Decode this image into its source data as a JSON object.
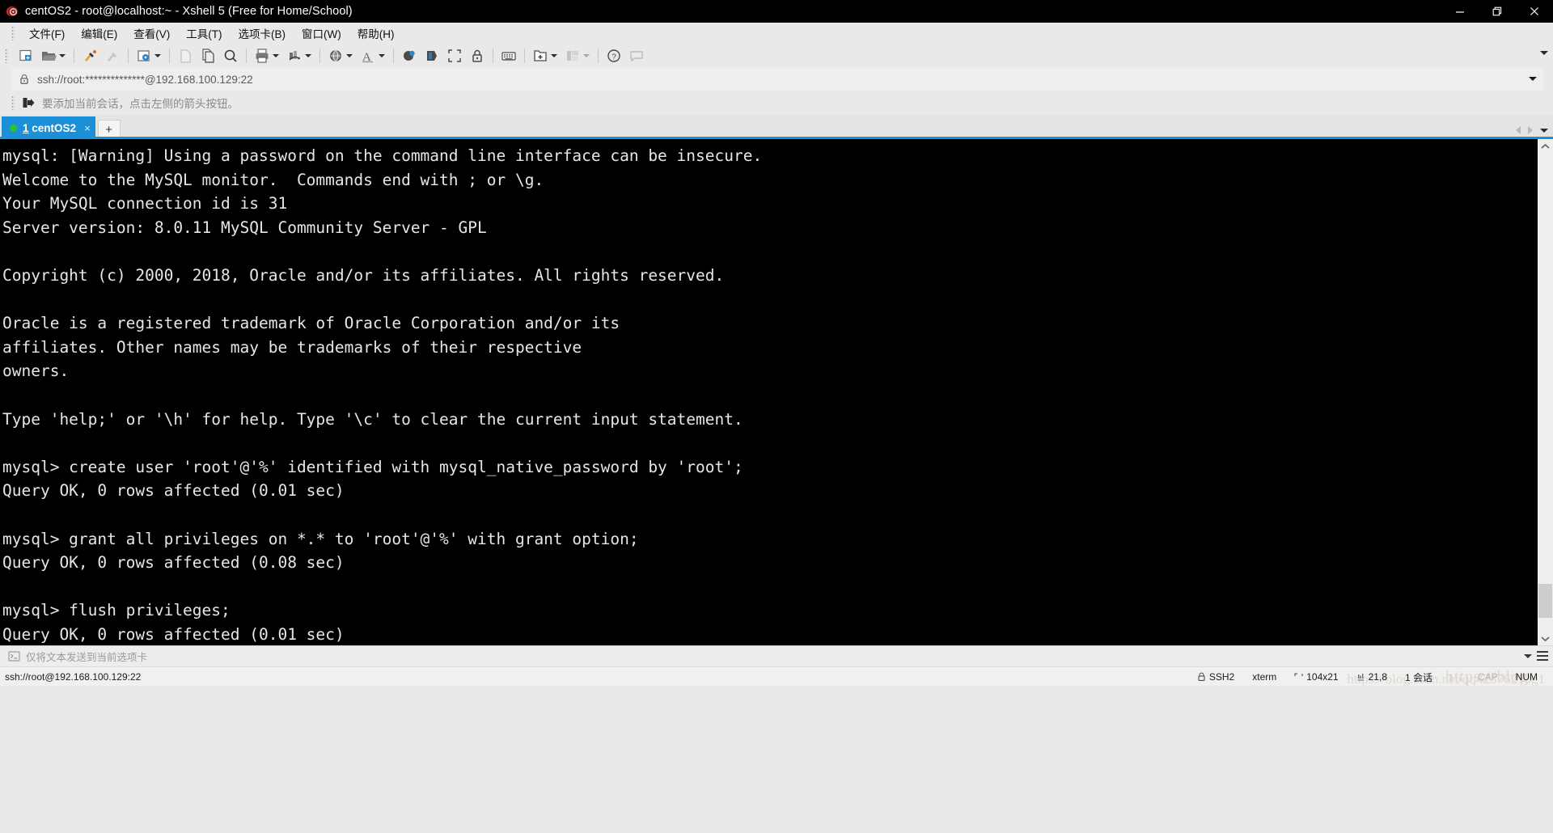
{
  "window": {
    "title": "centOS2 - root@localhost:~ - Xshell 5 (Free for Home/School)",
    "app_icon": "xshell-logo-icon",
    "minimize": "—",
    "restore": "❐",
    "close": "✕"
  },
  "menubar": {
    "items": [
      {
        "label": "文件(F)",
        "name": "menu-file"
      },
      {
        "label": "编辑(E)",
        "name": "menu-edit"
      },
      {
        "label": "查看(V)",
        "name": "menu-view"
      },
      {
        "label": "工具(T)",
        "name": "menu-tools"
      },
      {
        "label": "选项卡(B)",
        "name": "menu-tabs"
      },
      {
        "label": "窗口(W)",
        "name": "menu-window"
      },
      {
        "label": "帮助(H)",
        "name": "menu-help"
      }
    ]
  },
  "toolbar": {
    "items": [
      "new-session-icon",
      "open-folder-icon",
      "folder-dropdown-caret",
      "separator",
      "connect-icon",
      "disconnect-icon",
      "separator",
      "session-properties-icon",
      "properties-dropdown-caret",
      "separator",
      "cut-icon",
      "copy-icon",
      "find-icon",
      "separator",
      "print-icon",
      "print-dropdown-caret",
      "log-icon",
      "log-dropdown-caret",
      "separator",
      "globe-icon",
      "globe-dropdown-caret",
      "font-icon",
      "font-dropdown-caret",
      "separator",
      "compose-pane-icon",
      "highlight-icon",
      "fullscreen-icon",
      "lock-icon",
      "separator",
      "keyboard-icon",
      "separator",
      "new-folder-icon",
      "new-folder-dropdown-caret",
      "layout-icon",
      "layout-dropdown-caret",
      "separator",
      "help-icon",
      "feedback-icon"
    ],
    "overflow": "toolbar-overflow-caret"
  },
  "address_bar": {
    "lock_icon": "lock-icon",
    "value": "ssh://root:**************@192.168.100.129:22",
    "placeholder": "ssh://",
    "dropdown": "address-dropdown-caret"
  },
  "hint_bar": {
    "icon": "add-session-arrow-icon",
    "text": "要添加当前会话，点击左侧的箭头按钮。"
  },
  "tabbar": {
    "tabs": [
      {
        "index": "1",
        "label": "centOS2",
        "status": "connected",
        "close": "×"
      }
    ],
    "new_tab": "+",
    "nav_left": "tab-nav-left-icon",
    "nav_right": "tab-nav-right-icon",
    "tab_list": "tab-list-caret"
  },
  "terminal": {
    "lines": [
      "mysql: [Warning] Using a password on the command line interface can be insecure.",
      "Welcome to the MySQL monitor.  Commands end with ; or \\g.",
      "Your MySQL connection id is 31",
      "Server version: 8.0.11 MySQL Community Server - GPL",
      "",
      "Copyright (c) 2000, 2018, Oracle and/or its affiliates. All rights reserved.",
      "",
      "Oracle is a registered trademark of Oracle Corporation and/or its",
      "affiliates. Other names may be trademarks of their respective",
      "owners.",
      "",
      "Type 'help;' or '\\h' for help. Type '\\c' to clear the current input statement.",
      "",
      "mysql> create user 'root'@'%' identified with mysql_native_password by 'root';",
      "Query OK, 0 rows affected (0.01 sec)",
      "",
      "mysql> grant all privileges on *.* to 'root'@'%' with grant option;",
      "Query OK, 0 rows affected (0.08 sec)",
      "",
      "mysql> flush privileges;",
      "Query OK, 0 rows affected (0.01 sec)"
    ],
    "background": "#000000",
    "foreground": "#e6e6e6"
  },
  "send_bar": {
    "icon": "terminal-prompt-icon",
    "placeholder": "仅将文本发送到当前选项卡",
    "value": "",
    "dropdown": "send-bar-caret",
    "menu": "send-bar-menu-icon"
  },
  "status_bar": {
    "left": "ssh://root@192.168.100.129:22",
    "protocol_icon": "lock-icon",
    "protocol": "SSH2",
    "terminal_type": "xterm",
    "size_icon": "screen-size-icon",
    "size": "104x21",
    "cursor_icon": "cursor-position-icon",
    "cursor": "21,8",
    "sessions": "1 会话",
    "transfer_up": "↑",
    "transfer_down": "↓",
    "caps": "CAP",
    "num": "NUM",
    "watermark": "https://blog.",
    "watermark2": "https://blog.csdn.net/qq42376210g1"
  },
  "colors": {
    "accent": "#1b8fd8",
    "chrome": "#e9e9e9",
    "titlebar": "#000000",
    "terminal_bg": "#000000",
    "status_green": "#2ec12e"
  }
}
